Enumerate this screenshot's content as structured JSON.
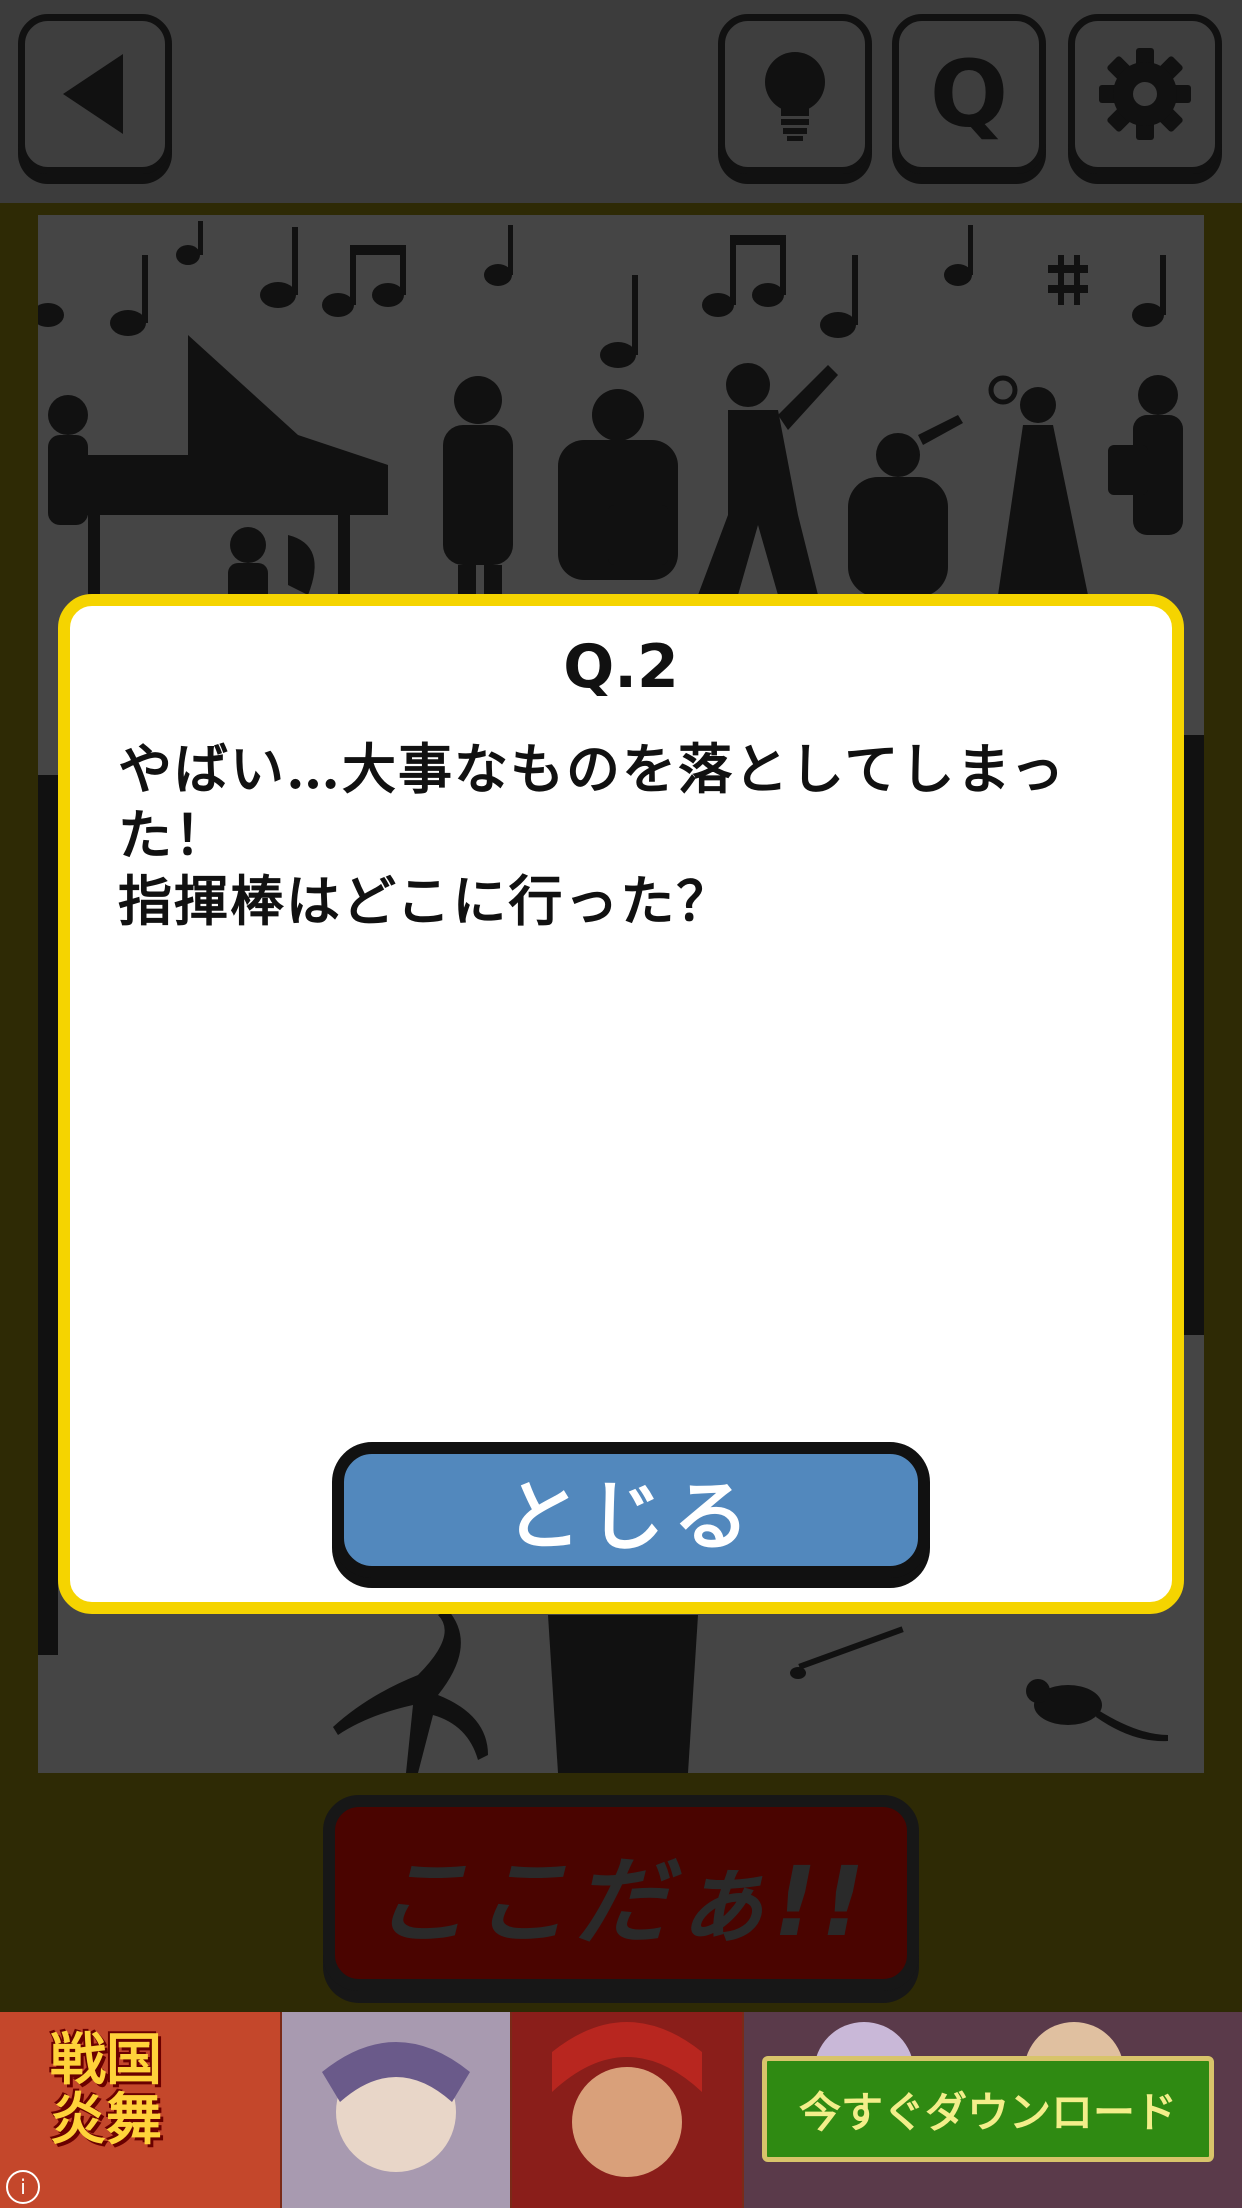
{
  "toolbar": {
    "back": "back-arrow-icon",
    "hint": "lightbulb-icon",
    "question": "Q",
    "settings": "gear-icon"
  },
  "modal": {
    "title": "Q.2",
    "text": "やばい…大事なものを落としてしまった！\n指揮棒はどこに行った？",
    "close_label": "とじる"
  },
  "answer_button": {
    "label": "ここだぁ!!"
  },
  "ad": {
    "logo_text": "戦国炎舞",
    "cta": "今すぐダウンロード",
    "info": "i"
  },
  "colors": {
    "modal_border": "#f5d400",
    "close_button": "#5288bd",
    "answer_button": "#4a0400",
    "background": "#2e2a05"
  }
}
